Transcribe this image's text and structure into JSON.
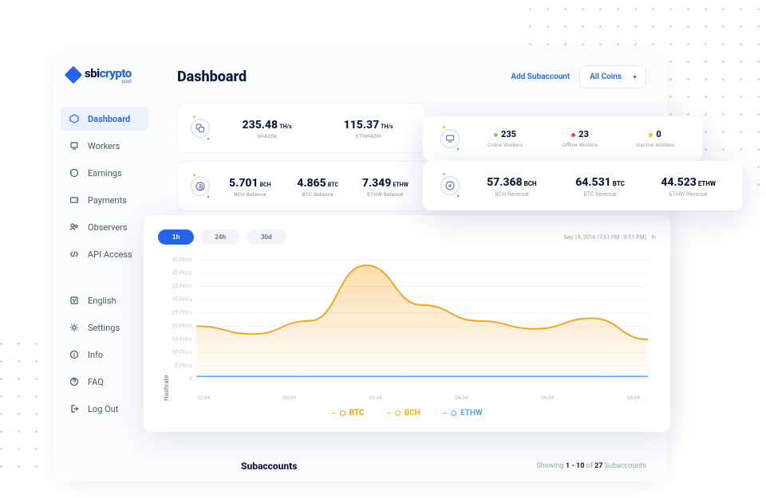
{
  "logo": {
    "textA": "sbi",
    "textB": "crypto",
    "sub": "pool"
  },
  "header": {
    "title": "Dashboard",
    "add_subaccount": "Add Subaccount",
    "coin_select": "All Coins"
  },
  "sidebar": {
    "items": [
      {
        "label": "Dashboard",
        "icon": "cube-icon",
        "active": true
      },
      {
        "label": "Workers",
        "icon": "workers-icon"
      },
      {
        "label": "Earnings",
        "icon": "earnings-icon"
      },
      {
        "label": "Payments",
        "icon": "payments-icon"
      },
      {
        "label": "Observers",
        "icon": "observers-icon"
      },
      {
        "label": "API Access",
        "icon": "api-icon"
      }
    ],
    "footer": [
      {
        "label": "English",
        "icon": "language-icon"
      },
      {
        "label": "Settings",
        "icon": "settings-icon"
      },
      {
        "label": "Info",
        "icon": "info-icon"
      },
      {
        "label": "FAQ",
        "icon": "faq-icon"
      },
      {
        "label": "Log Out",
        "icon": "logout-icon"
      }
    ]
  },
  "hashrate": {
    "a_val": "235.48",
    "a_unit": "TH/s",
    "a_label": "SHA256",
    "b_val": "115.37",
    "b_unit": "TH/s",
    "b_label": "ETHHASH"
  },
  "balances": {
    "a_val": "5.701",
    "a_unit": "BCH",
    "a_label": "BCH Balance",
    "b_val": "4.865",
    "b_unit": "BTC",
    "b_label": "BTC Balance",
    "c_val": "7.349",
    "c_unit": "ETHW",
    "c_label": "ETHW Balance"
  },
  "workers": {
    "online_val": "235",
    "online_lbl": "Online Workers",
    "online_color": "#7dd162",
    "offline_val": "23",
    "offline_lbl": "Offline Workers",
    "offline_color": "#f43f5e",
    "inactive_val": "0",
    "inactive_lbl": "Inactive Workers",
    "inactive_color": "#fbbf24"
  },
  "revenue": {
    "a_val": "57.368",
    "a_unit": "BCH",
    "a_lbl": "BCH Revenue",
    "b_val": "64.531",
    "b_unit": "BTC",
    "b_lbl": "BTC Revenue",
    "c_val": "44.523",
    "c_unit": "ETHW",
    "c_lbl": "ETHW Revenue"
  },
  "chart": {
    "ranges": [
      "1h",
      "24h",
      "30d"
    ],
    "active_range": 0,
    "meta": "Sep 19, 2016 (7:51 PM - 8:51 PM)",
    "y_axis": "Hashrate",
    "y_ticks": [
      "45 PH/s",
      "40 PH/s",
      "35 PH/s",
      "30 PH/s",
      "25 PH/s",
      "20 PH/s",
      "15 PH/s",
      "10 PH/s",
      "5 PH/s",
      "0"
    ],
    "x_ticks": [
      "22:04",
      "00:04",
      "02:04",
      "04:04",
      "06:04",
      "08:04"
    ],
    "legend": [
      {
        "label": "BTC",
        "color": "#f59e0b"
      },
      {
        "label": "BCH",
        "color": "#eab308"
      },
      {
        "label": "ETHW",
        "color": "#60a5fa"
      }
    ]
  },
  "subaccounts": {
    "title": "Subaccounts",
    "prefix": "Showing ",
    "range": "1 - 10",
    "mid": " of ",
    "total": "27",
    "suffix": " Subaccounts"
  },
  "chart_data": {
    "type": "line",
    "xlabel": "",
    "ylabel": "Hashrate",
    "ylim": [
      0,
      45
    ],
    "y_unit": "PH/s",
    "x": [
      "22:04",
      "00:04",
      "02:04",
      "04:04",
      "06:04",
      "08:04"
    ],
    "series": [
      {
        "name": "BTC",
        "color": "#f59e0b",
        "values": [
          20,
          17,
          22,
          43,
          28,
          22,
          19,
          23,
          15
        ],
        "area": true
      },
      {
        "name": "BCH",
        "color": "#eab308",
        "values": [
          1,
          1,
          1,
          1,
          1,
          1,
          1,
          1,
          1
        ]
      },
      {
        "name": "ETHW",
        "color": "#60a5fa",
        "values": [
          1,
          1,
          1,
          1,
          1,
          1,
          1,
          1,
          1
        ]
      }
    ]
  }
}
